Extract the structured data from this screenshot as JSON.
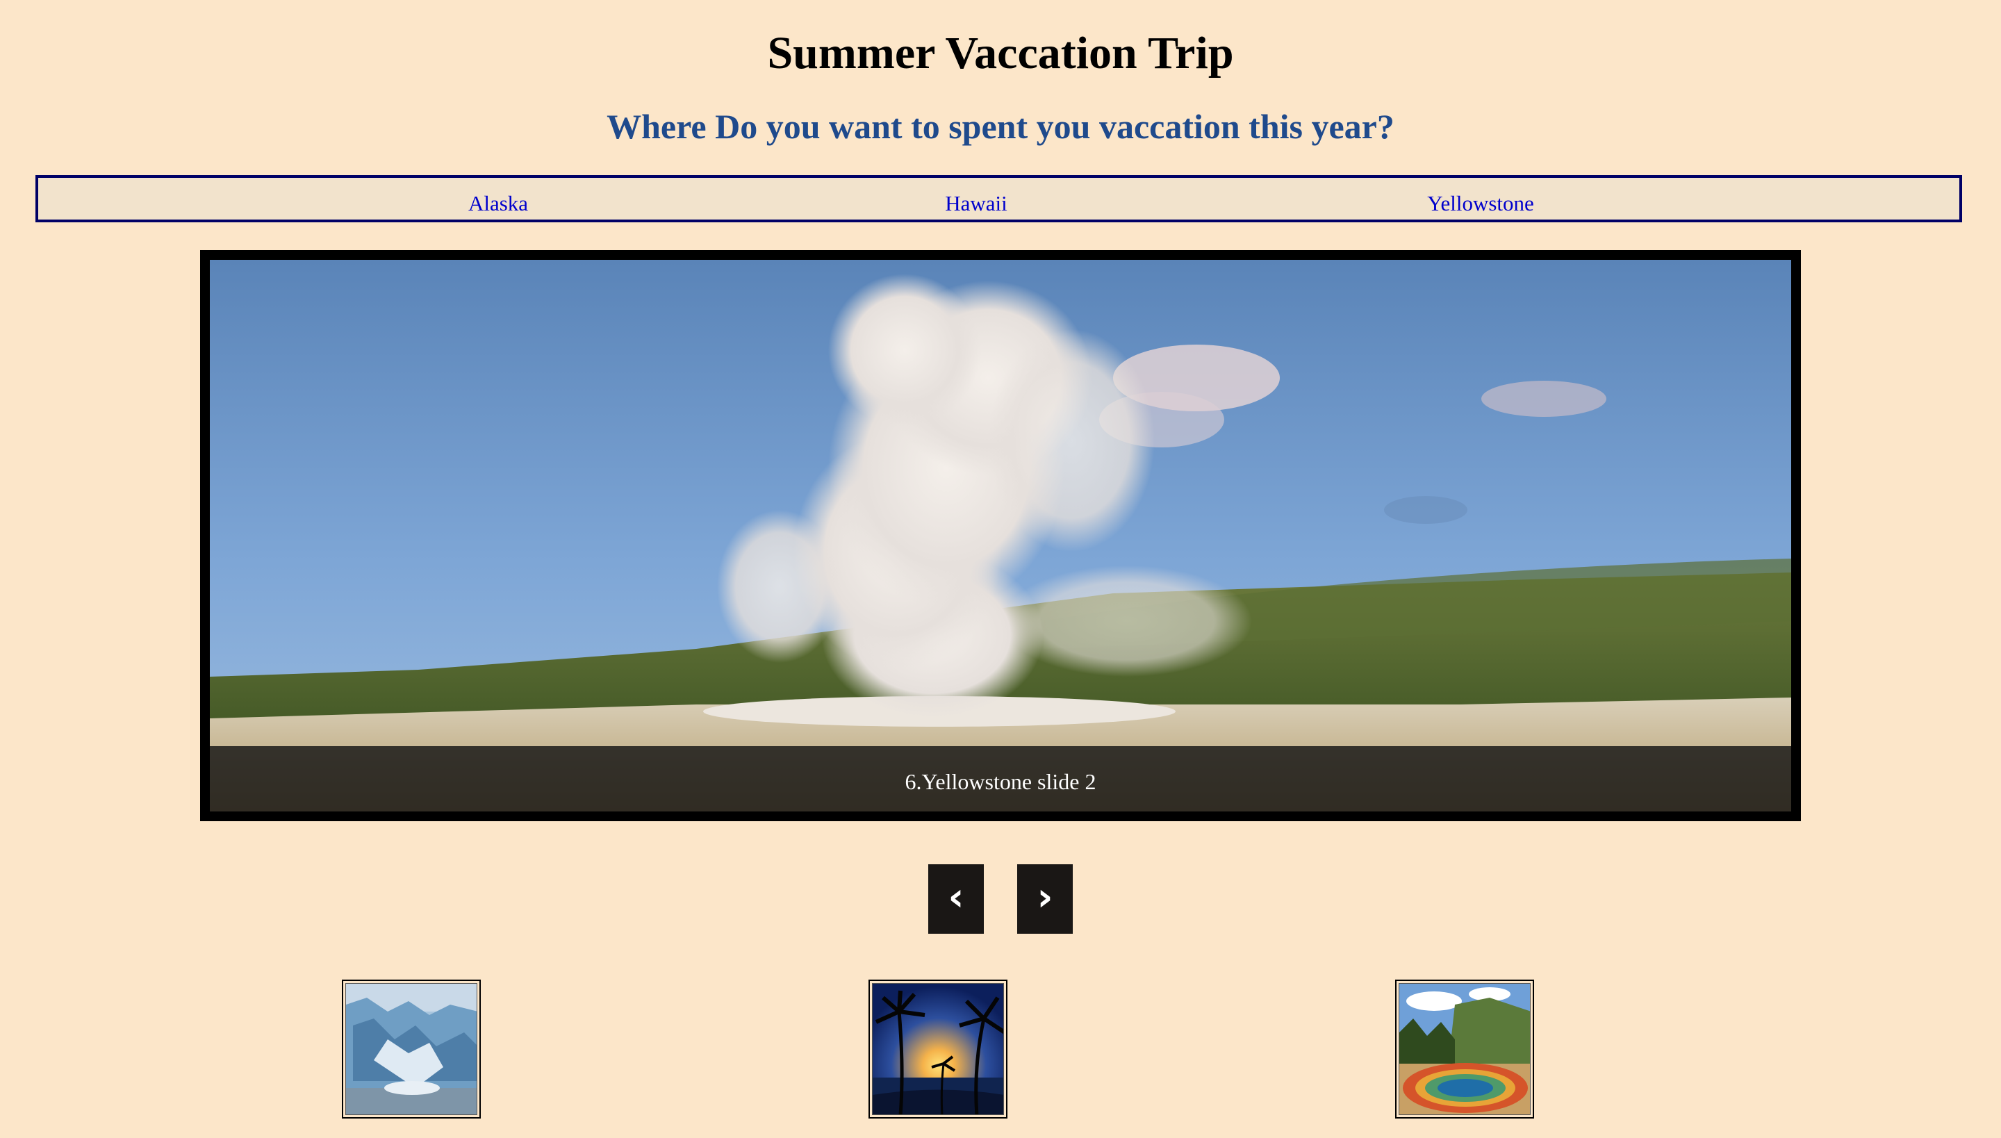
{
  "page": {
    "title": "Summer Vaccation Trip",
    "subtitle": "Where Do you want to spent you vaccation this year?"
  },
  "nav": {
    "items": [
      {
        "label": "Alaska"
      },
      {
        "label": "Hawaii"
      },
      {
        "label": "Yellowstone"
      }
    ]
  },
  "slideshow": {
    "caption": "6.Yellowstone slide 2",
    "prev_label": "‹",
    "next_label": "›"
  },
  "colors": {
    "background": "#fce6c9",
    "title": "#000000",
    "subtitle": "#1f4a8c",
    "nav_link": "#0000cc",
    "nav_border": "#000066",
    "button": "#1a1715"
  }
}
